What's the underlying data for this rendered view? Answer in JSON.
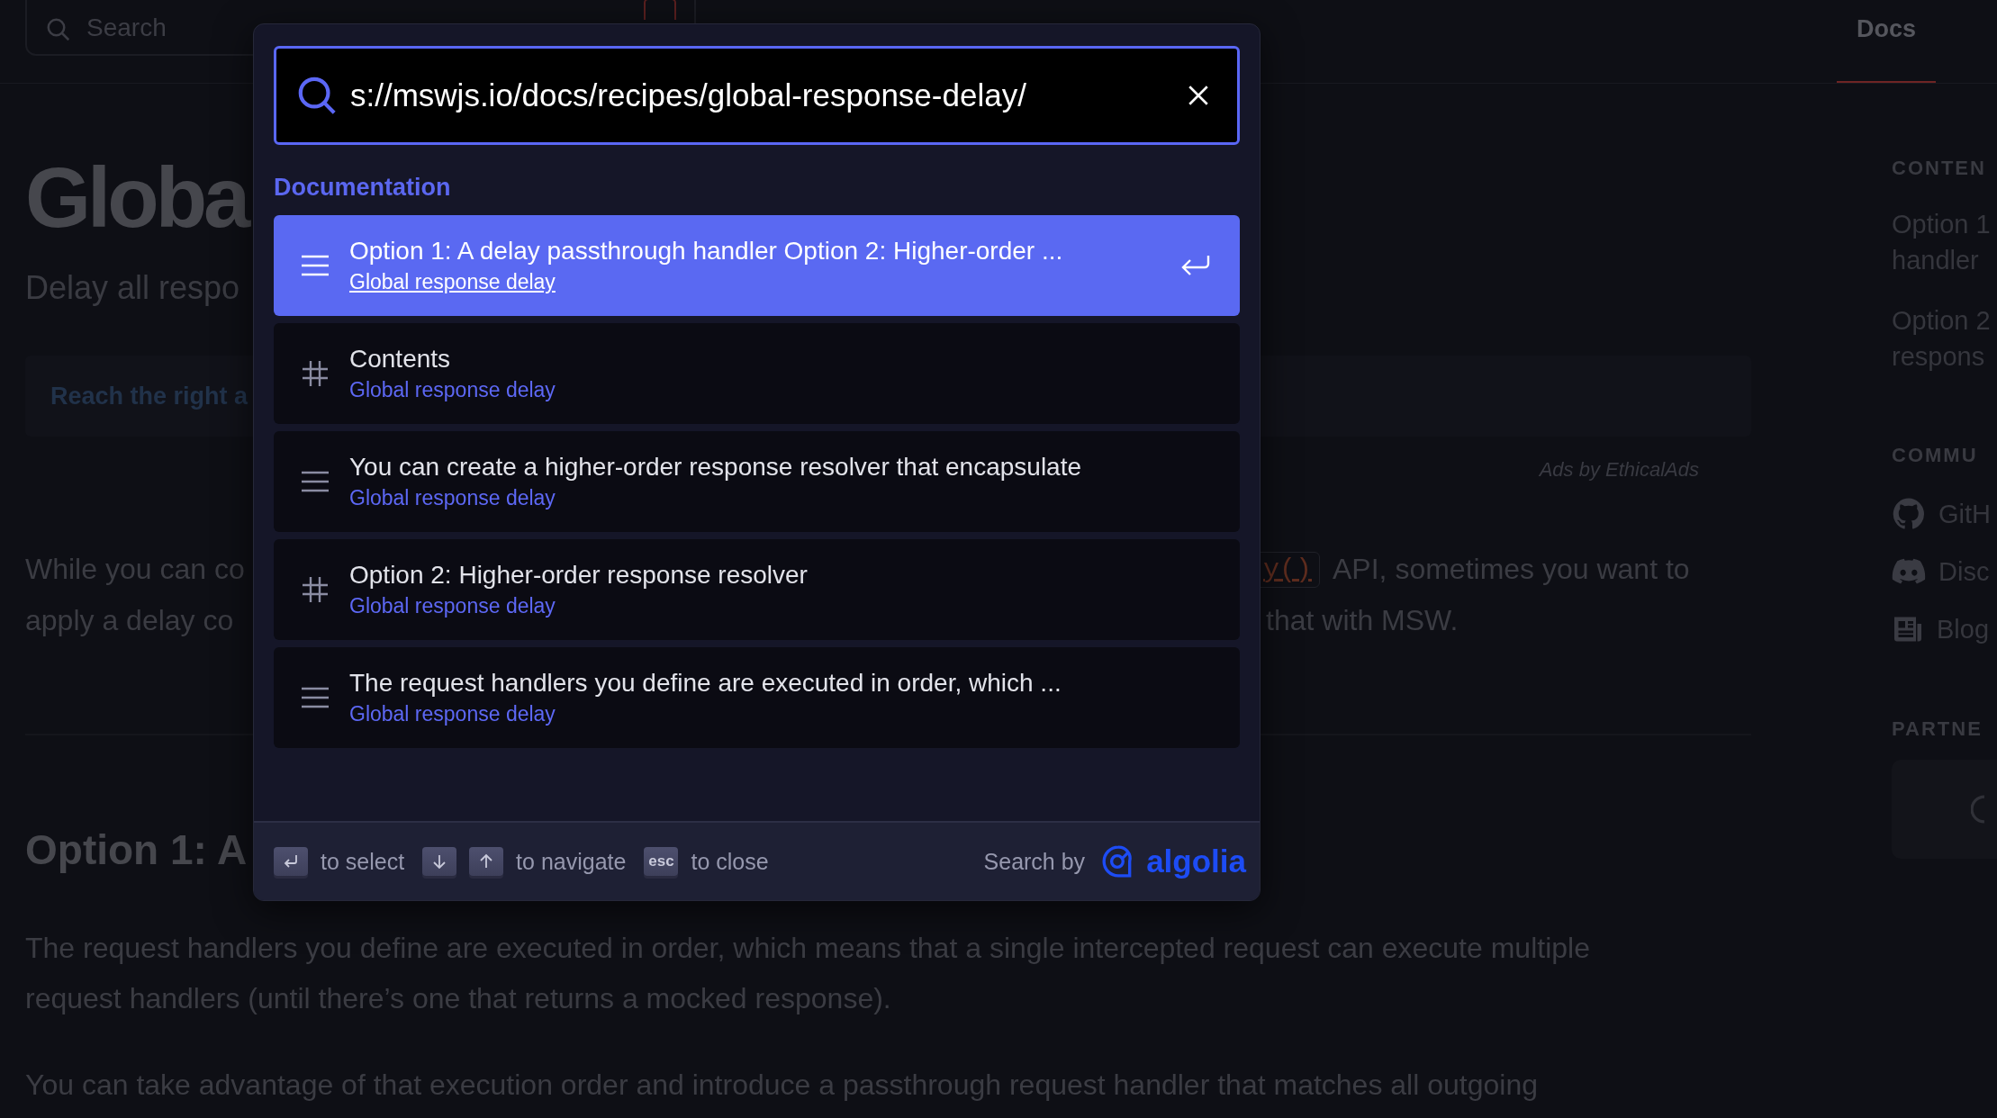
{
  "header": {
    "search": {
      "placeholder": "Search"
    },
    "nav": [
      {
        "label": "Docs",
        "selected": true
      }
    ]
  },
  "page": {
    "title": "Globa",
    "subtitle": "Delay all respo",
    "ad": {
      "text": "Reach the right a",
      "credit": "Ads by EthicalAds"
    },
    "intro": {
      "left": [
        "While you can co",
        "apply a delay co"
      ],
      "code": "y()",
      "right": [
        "API, sometimes you want to",
        "that with MSW."
      ]
    },
    "section_heading": "Option 1: A",
    "paragraphs": [
      [
        "The request handlers you define are executed in order, which means that a single intercepted request can execute multiple",
        "request handlers (until there’s one that returns a mocked response)."
      ],
      [
        "You can take advantage of that execution order and introduce a passthrough request handler that matches all outgoing"
      ]
    ]
  },
  "sidebar": {
    "contents": {
      "heading": "CONTEN",
      "items": [
        [
          "Option 1",
          "handler"
        ],
        [
          "Option 2",
          "respons"
        ]
      ]
    },
    "community": {
      "heading": "COMMU",
      "items": [
        {
          "kind": "github",
          "label": "GitH"
        },
        {
          "kind": "discord",
          "label": "Disc"
        },
        {
          "kind": "blog",
          "label": "Blog"
        }
      ]
    },
    "partners": {
      "heading": "PARTNE"
    }
  },
  "search_modal": {
    "query": "s://mswjs.io/docs/recipes/global-response-delay/",
    "group": "Documentation",
    "hits": [
      {
        "kind": "content",
        "title": "Option 1: A delay passthrough handler Option 2: Higher-order ...",
        "path": "Global response delay",
        "selected": true
      },
      {
        "kind": "heading",
        "title": "Contents",
        "path": "Global response delay",
        "selected": false
      },
      {
        "kind": "content",
        "title": "You can create a higher-order response resolver that encapsulate",
        "path": "Global response delay",
        "selected": false
      },
      {
        "kind": "heading",
        "title": "Option 2: Higher-order response resolver",
        "path": "Global response delay",
        "selected": false
      },
      {
        "kind": "content",
        "title": "The request handlers you define are executed in order, which ...",
        "path": "Global response delay",
        "selected": false
      }
    ],
    "footer": {
      "commands": [
        {
          "keys": [
            {
              "kind": "enter"
            }
          ],
          "label": "to select"
        },
        {
          "keys": [
            {
              "kind": "down"
            },
            {
              "kind": "up"
            }
          ],
          "label": "to navigate"
        },
        {
          "keys": [
            {
              "kind": "esc",
              "text": "esc"
            }
          ],
          "label": "to close"
        }
      ],
      "search_by": "Search by",
      "brand": "algolia"
    }
  }
}
